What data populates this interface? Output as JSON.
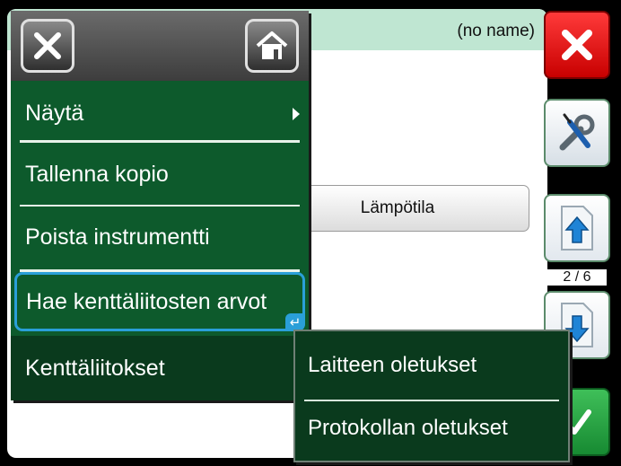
{
  "instrument": {
    "name": "(no name)",
    "quantity_label": "Lämpötila"
  },
  "side_toolbar": {
    "page_indicator": "2 / 6"
  },
  "menu": {
    "items": [
      {
        "label": "Näytä",
        "has_submenu": true
      },
      {
        "label": "Tallenna kopio"
      },
      {
        "label": "Poista instrumentti"
      },
      {
        "label": "Hae kenttäliitosten arvot",
        "selected": true
      },
      {
        "label": "Kenttäliitokset",
        "active": true
      }
    ]
  },
  "submenu": {
    "items": [
      {
        "label": "Laitteen oletukset"
      },
      {
        "label": "Protokollan oletukset"
      }
    ]
  },
  "colors": {
    "menu_green": "#0d5a2c",
    "menu_dark_green": "#0a3a1d",
    "selection_blue": "#2a9fd8",
    "header_bar": "#bfe6d2",
    "close_red": "#e01010",
    "accept_green": "#2aa845"
  },
  "icons": {
    "close": "close-icon",
    "home": "home-icon",
    "tools": "wrench-screwdriver-icon",
    "page_up": "page-up-arrow-icon",
    "page_down": "page-down-arrow-icon",
    "accept": "checkmark-icon",
    "enter": "enter-key-icon",
    "submenu": "chevron-right-icon"
  }
}
